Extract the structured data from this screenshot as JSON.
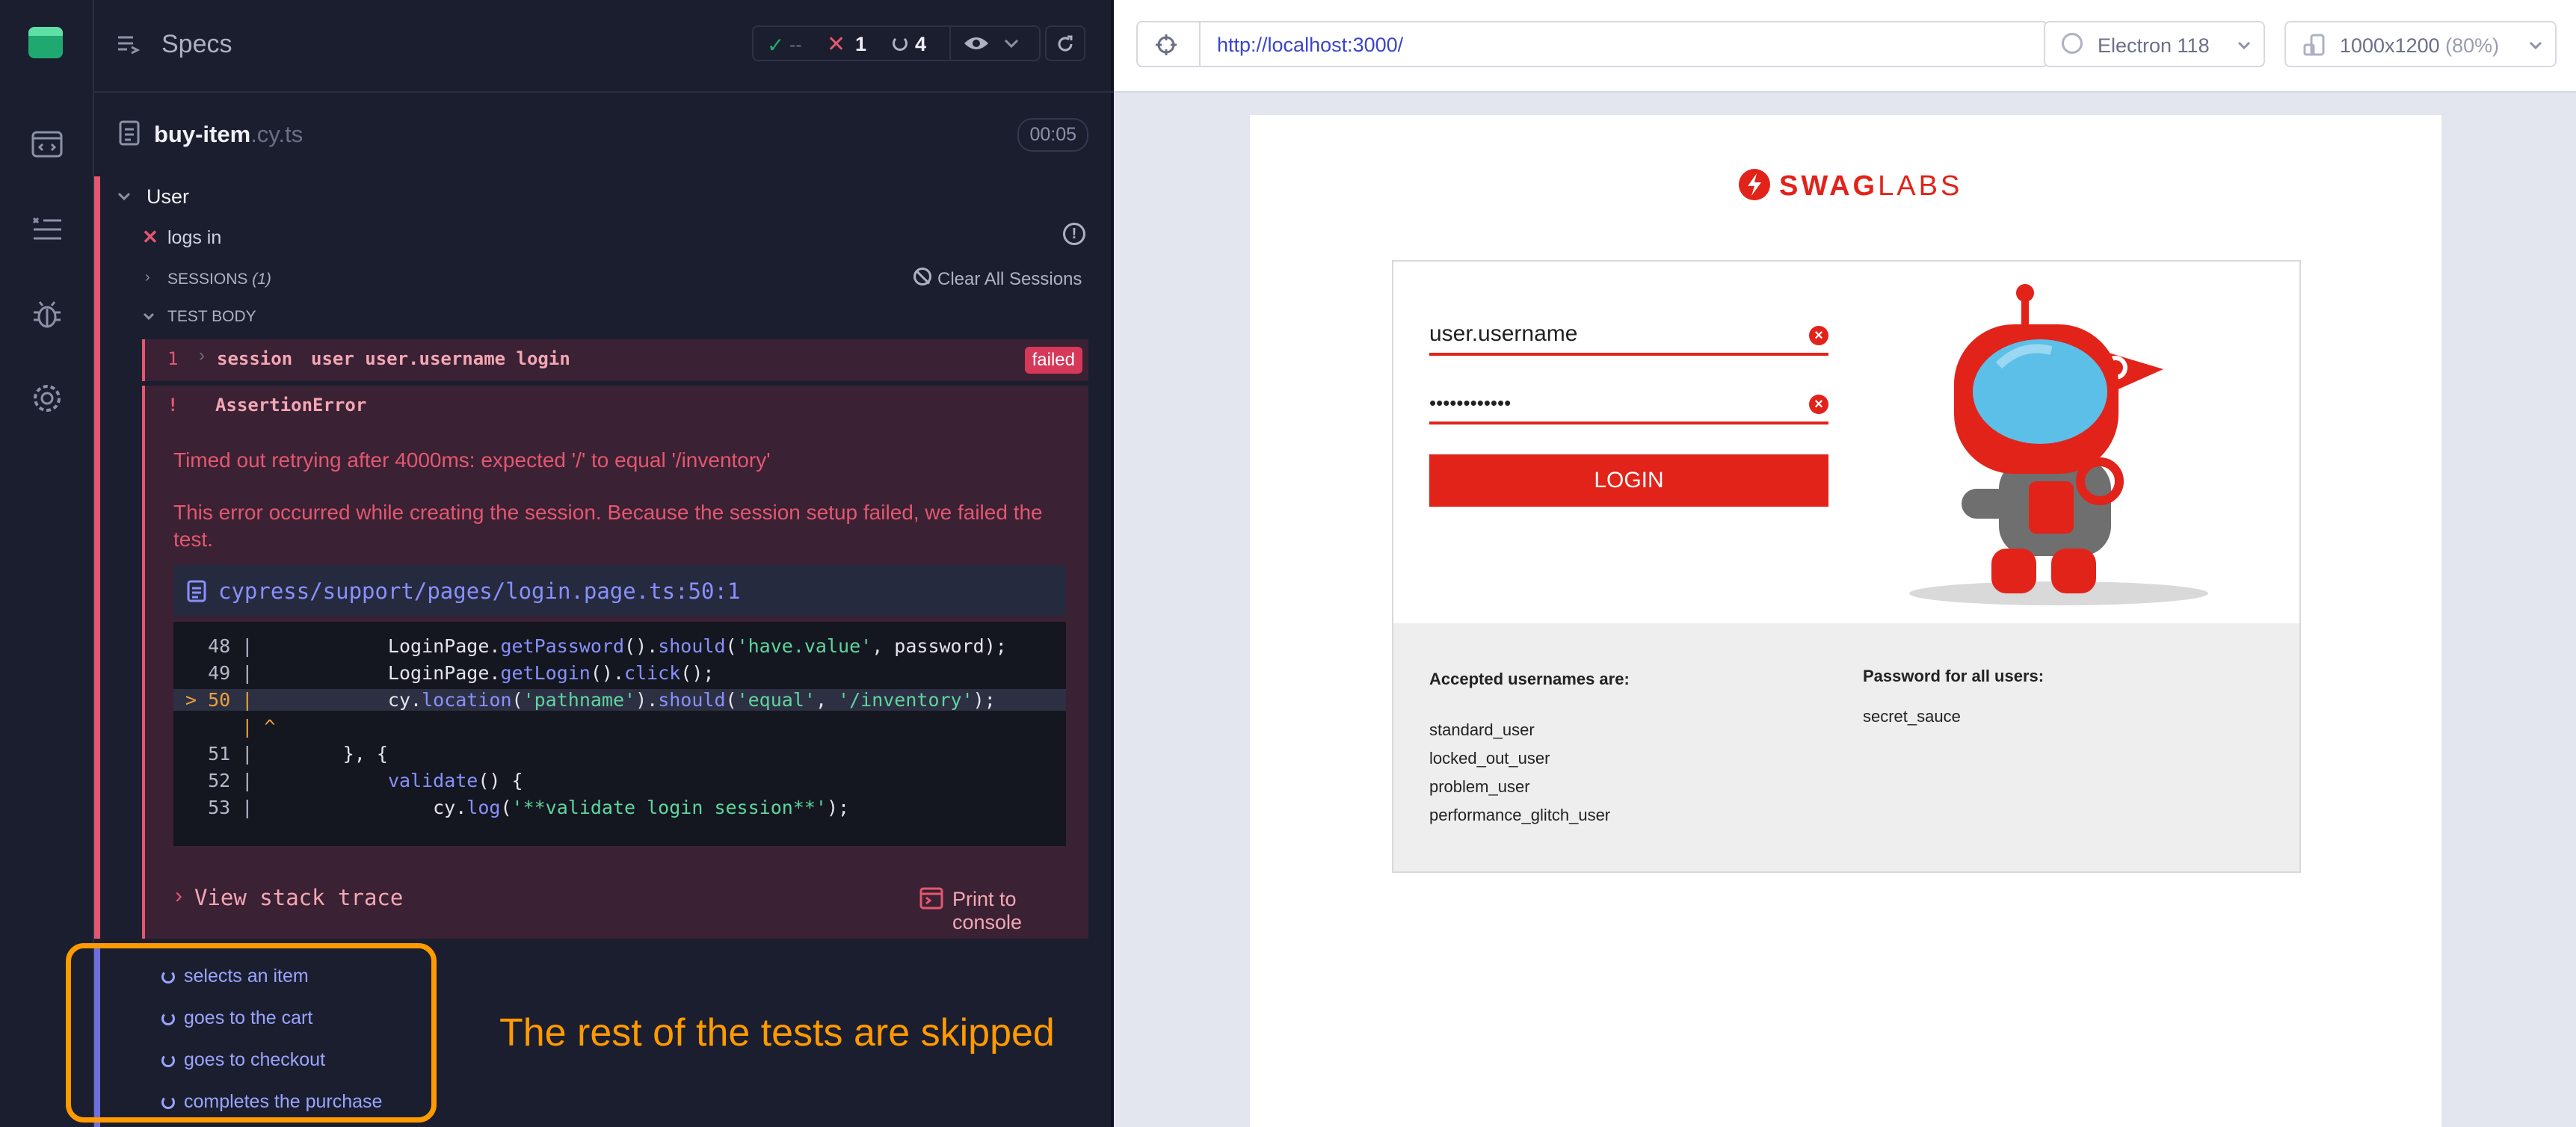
{
  "reporter": {
    "header_title": "Specs",
    "stats": {
      "passed": "--",
      "failed": "1",
      "pending": "4"
    },
    "spec": {
      "name": "buy-item",
      "ext": ".cy.ts",
      "duration": "00:05"
    },
    "suite": {
      "title": "User",
      "test": "logs in",
      "sessions_label": "SESSIONS",
      "sessions_count": "(1)",
      "clear_sessions": "Clear All Sessions",
      "test_body": "TEST BODY",
      "command": {
        "index": "1",
        "name": "session",
        "message": "user user.username login",
        "status": "failed"
      },
      "error": {
        "bang": "!",
        "name": "AssertionError",
        "message1": "Timed out retrying after 4000ms: expected '/' to equal '/inventory'",
        "message2": "This error occurred while creating the session. Because the session setup failed, we failed the test.",
        "file": "cypress/support/pages/login.page.ts:50:1",
        "code": [
          {
            "ln": "  48 |",
            "parts": [
              [
                "",
                "            LoginPage."
              ],
              [
                "kw",
                "getPassword"
              ],
              [
                "",
                "()."
              ],
              [
                "kw",
                "should"
              ],
              [
                "",
                "("
              ],
              [
                "str",
                "'have.value'"
              ],
              [
                "",
                ", password);"
              ]
            ]
          },
          {
            "ln": "  49 |",
            "parts": [
              [
                "",
                "            LoginPage."
              ],
              [
                "kw",
                "getLogin"
              ],
              [
                "",
                "()."
              ],
              [
                "kw",
                "click"
              ],
              [
                "",
                "();"
              ]
            ]
          },
          {
            "ln": "> 50 |",
            "parts": [
              [
                "",
                "            cy."
              ],
              [
                "kw",
                "location"
              ],
              [
                "",
                "("
              ],
              [
                "str",
                "'pathname'"
              ],
              [
                "",
                ")."
              ],
              [
                "kw",
                "should"
              ],
              [
                "",
                "("
              ],
              [
                "str",
                "'equal'"
              ],
              [
                "",
                ", "
              ],
              [
                "str",
                "'/inventory'"
              ],
              [
                "",
                ");"
              ]
            ]
          },
          {
            "ln": "     |",
            "parts": [
              [
                "",
                " ^"
              ]
            ]
          },
          {
            "ln": "  51 |",
            "parts": [
              [
                "",
                "        }, {"
              ]
            ]
          },
          {
            "ln": "  52 |",
            "parts": [
              [
                "",
                "            "
              ],
              [
                "kw",
                "validate"
              ],
              [
                "",
                "() {"
              ]
            ]
          },
          {
            "ln": "  53 |",
            "parts": [
              [
                "",
                "                cy."
              ],
              [
                "kw",
                "log"
              ],
              [
                "",
                "("
              ],
              [
                "str",
                "'**validate login session**'"
              ],
              [
                "",
                ");"
              ]
            ]
          }
        ],
        "view_stack": "View stack trace",
        "print_console": "Print to console"
      }
    },
    "skipped": [
      "selects an item",
      "goes to the cart",
      "goes to checkout",
      "completes the purchase"
    ],
    "annotation": "The rest of the tests are skipped"
  },
  "browser": {
    "url": "http://localhost:3000/",
    "browser_name": "Electron 118",
    "viewport_size": "1000x1200",
    "viewport_scale": "(80%)"
  },
  "app": {
    "logo_swag": "SWAG",
    "logo_labs": "LABS",
    "username_value": "user.username",
    "password_value": "••••••••••••",
    "login_label": "LOGIN",
    "accepted_title": "Accepted usernames are:",
    "usernames": [
      "standard_user",
      "locked_out_user",
      "problem_user",
      "performance_glitch_user"
    ],
    "password_title": "Password for all users:",
    "password_hint": "secret_sauce"
  },
  "colors": {
    "fail": "#e45770",
    "accent": "#9aa4ff",
    "annotation": "#ff9a00",
    "brand": "#e2231a"
  }
}
